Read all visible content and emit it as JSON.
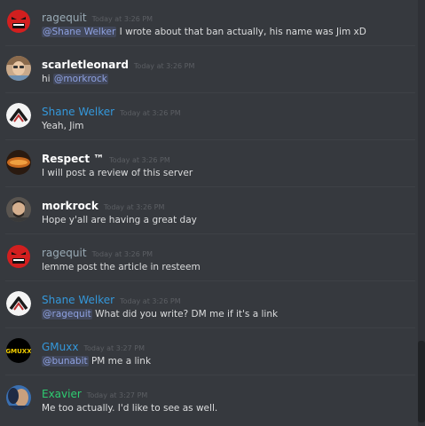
{
  "colors": {
    "background": "#36393e",
    "username_default": "#ffffff",
    "username_blue": "#3498db",
    "username_grey": "#99aab5",
    "username_green": "#2ecc71",
    "mention": "#8ea1e1",
    "text": "#dcddde"
  },
  "messages": [
    {
      "username": "ragequit",
      "timestamp": "Today at 3:26 PM",
      "mention": "@Shane Welker",
      "text": " I wrote about that ban actually, his name was Jim xD",
      "avatar_icon": "red-angry-face-icon"
    },
    {
      "username": "scarletleonard",
      "timestamp": "Today at 3:26 PM",
      "prefix": "hi ",
      "mention": "@morkrock",
      "avatar_icon": "user-photo-icon"
    },
    {
      "username": "Shane Welker",
      "timestamp": "Today at 3:26 PM",
      "text": "Yeah, Jim",
      "avatar_icon": "ball-mark-icon"
    },
    {
      "username": "Respect ™",
      "timestamp": "Today at 3:26 PM",
      "text": "I will post a review of this server",
      "avatar_icon": "respect-logo-icon"
    },
    {
      "username": "morkrock",
      "timestamp": "Today at 3:26 PM",
      "text": "Hope y'all are having a great day",
      "avatar_icon": "user-photo-icon"
    },
    {
      "username": "ragequit",
      "timestamp": "Today at 3:26 PM",
      "text": "lemme post the article in resteem",
      "avatar_icon": "red-angry-face-icon"
    },
    {
      "username": "Shane Welker",
      "timestamp": "Today at 3:26 PM",
      "mention": "@ragequit",
      "text": " What did you write? DM me if it's a link",
      "avatar_icon": "ball-mark-icon"
    },
    {
      "username": "GMuxx",
      "timestamp": "Today at 3:27 PM",
      "mention": "@bunabit",
      "text": " PM me a link",
      "avatar_icon": "gmuxx-logo-icon",
      "avatar_text": "GMUXX"
    },
    {
      "username": "Exavier",
      "timestamp": "Today at 3:27 PM",
      "text": "Me too actually. I'd like to see as well.",
      "avatar_icon": "user-photo-icon"
    }
  ]
}
